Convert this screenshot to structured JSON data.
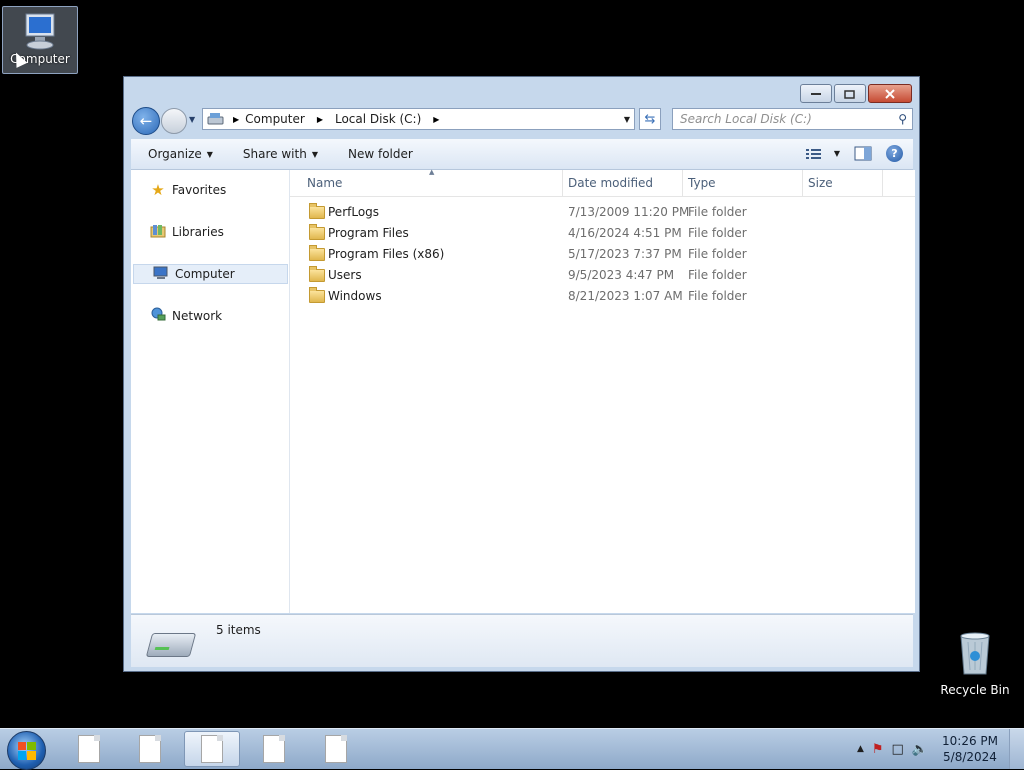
{
  "desktop": {
    "icons": [
      {
        "label": "Computer"
      },
      {
        "label": "Recycle Bin"
      }
    ]
  },
  "window": {
    "address": {
      "crumbs": [
        "Computer",
        "Local Disk (C:)"
      ]
    },
    "search": {
      "placeholder": "Search Local Disk (C:)"
    },
    "toolbar": {
      "organize": "Organize",
      "share_with": "Share with",
      "new_folder": "New folder"
    },
    "nav_pane": {
      "items": [
        {
          "label": "Favorites",
          "icon": "star-icon"
        },
        {
          "label": "Libraries",
          "icon": "libraries-icon"
        },
        {
          "label": "Computer",
          "icon": "computer-icon",
          "selected": true
        },
        {
          "label": "Network",
          "icon": "network-icon"
        }
      ]
    },
    "columns": {
      "name": "Name",
      "date": "Date modified",
      "type": "Type",
      "size": "Size"
    },
    "files": [
      {
        "name": "PerfLogs",
        "date": "7/13/2009 11:20 PM",
        "type": "File folder"
      },
      {
        "name": "Program Files",
        "date": "4/16/2024 4:51 PM",
        "type": "File folder"
      },
      {
        "name": "Program Files (x86)",
        "date": "5/17/2023 7:37 PM",
        "type": "File folder"
      },
      {
        "name": "Users",
        "date": "9/5/2023 4:47 PM",
        "type": "File folder"
      },
      {
        "name": "Windows",
        "date": "8/21/2023 1:07 AM",
        "type": "File folder"
      }
    ],
    "status": {
      "count": "5 items"
    }
  },
  "taskbar": {
    "clock": {
      "time": "10:26 PM",
      "date": "5/8/2024"
    }
  },
  "colors": {
    "accent": "#2d6ab8",
    "selection": "#e5eef9"
  }
}
